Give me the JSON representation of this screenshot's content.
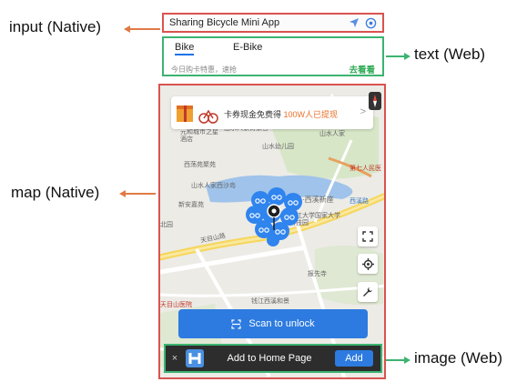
{
  "annotations": {
    "input": "input (Native)",
    "text": "text (Web)",
    "map": "map (Native)",
    "image": "image (Web)"
  },
  "top_bar": {
    "title": "Sharing Bicycle Mini App",
    "icons": [
      "navigation-arrow-icon",
      "target-icon"
    ]
  },
  "tabs": {
    "items": [
      "Bike",
      "E-Bike"
    ],
    "active": "Bike",
    "promo_text": "今日购卡特惠，速抢",
    "promo_link": "去看看"
  },
  "banner": {
    "text": "卡券现金免费得 ",
    "highlight": "100W人已提现",
    "chevron": ">"
  },
  "map_labels": {
    "l1": "山水人家诗家谷",
    "l2": "山水人家",
    "l3": "元和城市之星酒店",
    "l4": "山水幼儿园",
    "l5": "西荡苑聚苑",
    "l6": "山水人家西沙岛",
    "l7": "新安嘉苑",
    "l8": "钱江·西溪新座",
    "l9": "西溪路",
    "l10": "浙江大学国家大学科技园",
    "l11": "天目山路",
    "l12": "第七人民医",
    "l13": "报先寺",
    "l14": "钱江西溪和景",
    "l15": "天目山医院",
    "l16": "北园"
  },
  "scan_button": {
    "label": "Scan to unlock"
  },
  "add_bar": {
    "close": "×",
    "text": "Add to Home Page",
    "button": "Add"
  },
  "colors": {
    "native_border": "#d9534f",
    "web_border": "#3cb371",
    "primary_blue": "#2d7be0",
    "bike_cluster": "#2f84ee"
  }
}
